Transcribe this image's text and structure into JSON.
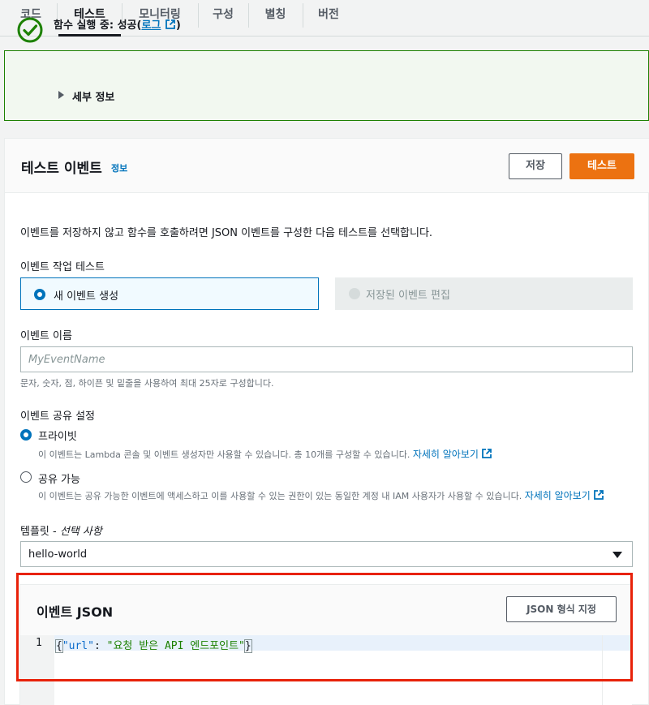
{
  "tabs": [
    {
      "label": "코드"
    },
    {
      "label": "테스트"
    },
    {
      "label": "모니터링"
    },
    {
      "label": "구성"
    },
    {
      "label": "별칭"
    },
    {
      "label": "버전"
    }
  ],
  "alert": {
    "title_prefix": "함수 실행 중: 성공(",
    "log_link": "로그",
    "title_suffix": ")",
    "details_label": "세부 정보",
    "color": "#1d8102"
  },
  "panel": {
    "title": "테스트 이벤트",
    "info": "정보",
    "save_label": "저장",
    "test_label": "테스트"
  },
  "intro": "이벤트를 저장하지 않고 함수를 호출하려면 JSON 이벤트를 구성한 다음 테스트를 선택합니다.",
  "event_action": {
    "label": "이벤트 작업 테스트",
    "new_event": "새 이벤트 생성",
    "edit_saved": "저장된 이벤트 편집"
  },
  "event_name": {
    "label": "이벤트 이름",
    "placeholder": "MyEventName",
    "hint": "문자, 숫자, 점, 하이픈 및 밑줄을 사용하여 최대 25자로 구성합니다."
  },
  "sharing": {
    "label": "이벤트 공유 설정",
    "private_label": "프라이빗",
    "private_desc": "이 이벤트는 Lambda 콘솔 및 이벤트 생성자만 사용할 수 있습니다. 총 10개를 구성할 수 있습니다.",
    "shareable_label": "공유 가능",
    "shareable_desc": "이 이벤트는 공유 가능한 이벤트에 액세스하고 이를 사용할 수 있는 권한이 있는 동일한 계정 내 IAM 사용자가 사용할 수 있습니다.",
    "learn_more": "자세히 알아보기"
  },
  "template": {
    "label": "템플릿 - ",
    "label_optional": "선택 사항",
    "value": "hello-world"
  },
  "event_json": {
    "title": "이벤트 JSON",
    "format_label": "JSON 형식 지정",
    "line_number": "1",
    "code_open": "{",
    "code_key": "\"url\"",
    "code_colon": ": ",
    "code_value": "\"요청 받은 API 엔드포인트\"",
    "code_close": "}"
  },
  "colors": {
    "accent": "#0073bb",
    "primary_button": "#ec7211",
    "highlight_border": "#e8220a"
  }
}
